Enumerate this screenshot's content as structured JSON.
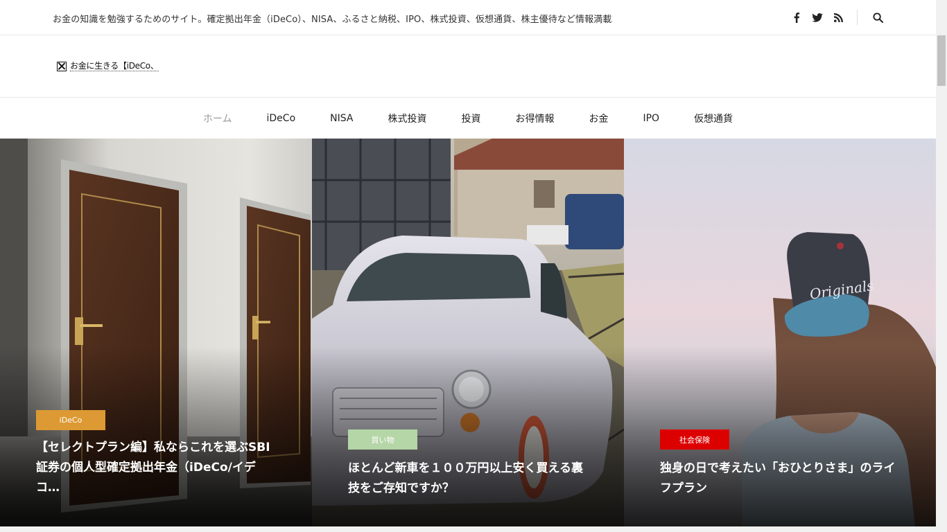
{
  "header": {
    "tagline": "お金の知識を勉強するためのサイト。確定拠出年金（iDeCo）、NISA、ふるさと納税、IPO、株式投資、仮想通貨、株主優待など情報満載",
    "social_icons": [
      "facebook-icon",
      "twitter-icon",
      "rss-icon"
    ],
    "search_icon": "search-icon"
  },
  "logo": {
    "alt_text": "お金に生きる【iDeCo、"
  },
  "nav": {
    "items": [
      {
        "label": "ホーム",
        "active": true
      },
      {
        "label": "iDeCo",
        "active": false
      },
      {
        "label": "NISA",
        "active": false
      },
      {
        "label": "株式投資",
        "active": false
      },
      {
        "label": "投資",
        "active": false
      },
      {
        "label": "お得情報",
        "active": false
      },
      {
        "label": "お金",
        "active": false
      },
      {
        "label": "IPO",
        "active": false
      },
      {
        "label": "仮想通貨",
        "active": false
      }
    ]
  },
  "featured": [
    {
      "category": "iDeCo",
      "category_color": "#dd9933",
      "title": "【セレクトプラン編】私ならこれを選ぶSBI証券の個人型確定拠出年金（iDeCo/イデコ…"
    },
    {
      "category": "買い物",
      "category_color": "#b5d6a7",
      "title": "ほとんど新車を１００万円以上安く買える裏技をご存知ですか？"
    },
    {
      "category": "社会保険",
      "category_color": "#dd0000",
      "title": "独身の日で考えたい「おひとりさま」のライフプラン"
    }
  ]
}
